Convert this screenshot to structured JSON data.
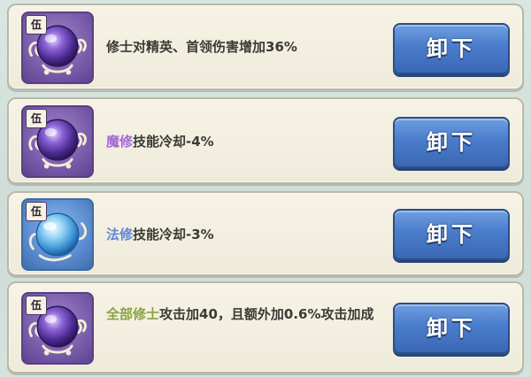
{
  "colors": {
    "highlight_purple": "#a168d6",
    "highlight_blue": "#5f86d4",
    "highlight_green": "#8aa43f",
    "button_blue": "#4a7ccb",
    "purple_orb": "#7c60ad",
    "blue_orb": "#5e8fd3"
  },
  "items": [
    {
      "grade": "伍",
      "icon": "purple-orb-icon",
      "desc_highlight": "",
      "desc_text": "修士对精英、首领伤害增加36%",
      "button_label": "卸下"
    },
    {
      "grade": "伍",
      "icon": "purple-orb-icon",
      "desc_highlight": "魔修",
      "desc_text": "技能冷却-4%",
      "button_label": "卸下"
    },
    {
      "grade": "伍",
      "icon": "blue-orb-icon",
      "desc_highlight": "法修",
      "desc_text": "技能冷却-3%",
      "button_label": "卸下"
    },
    {
      "grade": "伍",
      "icon": "purple-orb-icon",
      "desc_highlight": "全部修士",
      "desc_text": "攻击加40，且额外加0.6%攻击加成",
      "button_label": "卸下"
    }
  ]
}
